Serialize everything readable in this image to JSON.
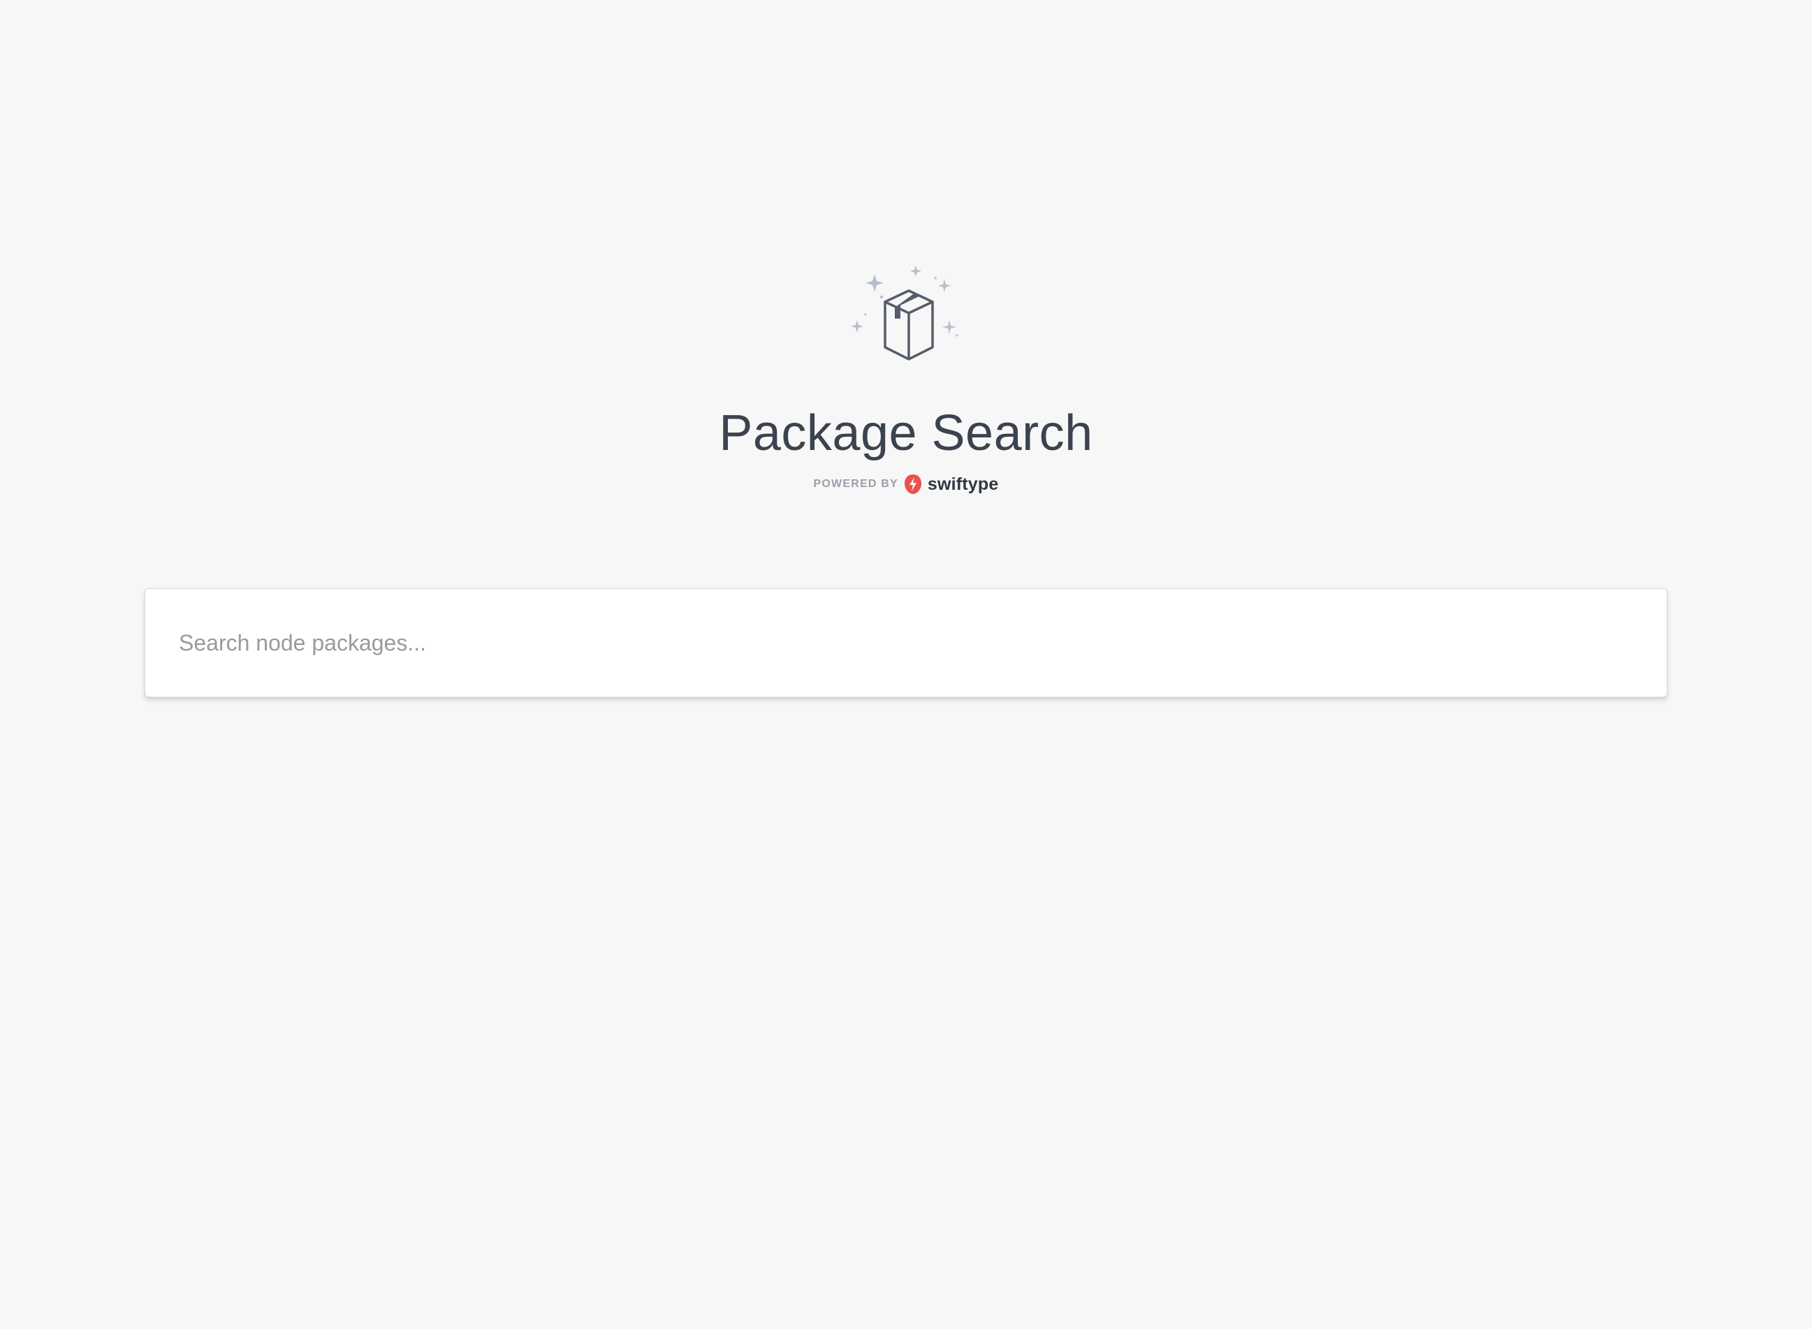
{
  "hero": {
    "logo_icon": "sparkling-package-box-icon",
    "title": "Package Search",
    "powered_by_label": "POWERED BY",
    "brand_name": "swiftype",
    "brand_icon": "swiftype-bolt-icon",
    "brand_color": "#e8544b"
  },
  "search": {
    "placeholder": "Search node packages...",
    "value": ""
  },
  "colors": {
    "background": "#f7f7f7",
    "title": "#3b4350",
    "icon_stroke": "#555d69",
    "sparkle": "#b8bfcc"
  }
}
